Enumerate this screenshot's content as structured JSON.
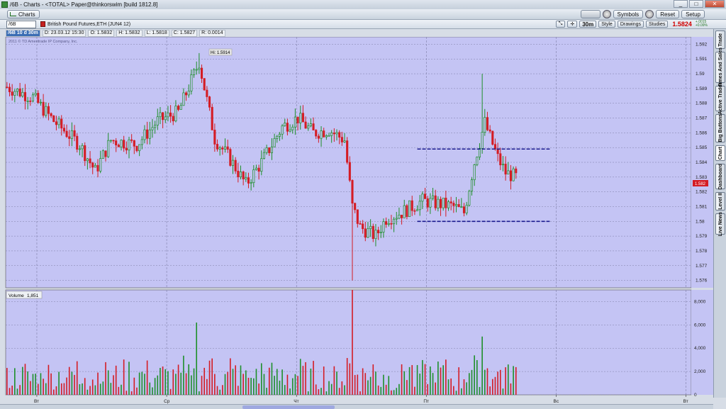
{
  "window": {
    "title": "/6B - Charts - <TOTAL> Paper@thinkorswim [build 1812.8]",
    "min_label": "_",
    "max_label": "□",
    "close_label": "✕"
  },
  "toolbar": {
    "charts_label": "Charts",
    "symbols_label": "Symbols",
    "reset_label": "Reset",
    "setup_label": "Setup"
  },
  "chart_header": {
    "symbol": "/6B",
    "description": "British Pound Futures,ETH (JUN4 12)",
    "period": "30m",
    "style_label": "Style",
    "drawings_label": "Drawings",
    "studies_label": "Studies",
    "last_price": "1.5824",
    "change_line1": "+.0015",
    "change_line2": "+0.09%"
  },
  "info_bar": {
    "aggregation": "/6B 10 d 30m",
    "date": "D: 23.03.12 15:30",
    "open": "O: 1.5832",
    "high": "H: 1.5832",
    "low": "L: 1.5818",
    "close": "C: 1.5827",
    "range": "R: 0.0014"
  },
  "copyright": "2011 © TD Ameritrade IP Company, Inc.",
  "volume_label": "Volume",
  "volume_value": "1,851",
  "high_annotation": "Hi: 1.5914",
  "price_tag": "1.582",
  "sidebar_tabs": [
    "Trade",
    "Times And Sales",
    "Active Trader",
    "Big Buttons",
    "Chart",
    "Dashboard",
    "Level II",
    "Live News"
  ],
  "chart_data": {
    "type": "candlestick",
    "price_axis": {
      "ylim": [
        1.5755,
        1.5925
      ],
      "ticks": [
        "1.592",
        "1.591",
        "1.59",
        "1.589",
        "1.588",
        "1.587",
        "1.586",
        "1.585",
        "1.584",
        "1.583",
        "1.582",
        "1.581",
        "1.58",
        "1.579",
        "1.578",
        "1.577",
        "1.576"
      ]
    },
    "volume_axis": {
      "ylim": [
        0,
        9000
      ],
      "ticks": [
        "8,000",
        "6,000",
        "4,000",
        "2,000",
        "0"
      ]
    },
    "x_ticks": [
      "Вт",
      "Ср",
      "Чт",
      "Пт",
      "Вс",
      "Вт"
    ],
    "day_boundaries": [
      12,
      62,
      112,
      162
    ],
    "total_slots": 264,
    "horizontal_levels": [
      {
        "price": 1.5849,
        "from_bar": 158,
        "to_bar": 209,
        "color": "#1b1b8f"
      },
      {
        "price": 1.58,
        "from_bar": 158,
        "to_bar": 209,
        "color": "#1b1b8f"
      }
    ],
    "grid": true
  },
  "colors": {
    "chart_bg": "#c4c4f4",
    "up": "#1e8f2a",
    "down": "#d41c24",
    "grid": "#7f7fa8",
    "level_line": "#1b1b8f"
  }
}
